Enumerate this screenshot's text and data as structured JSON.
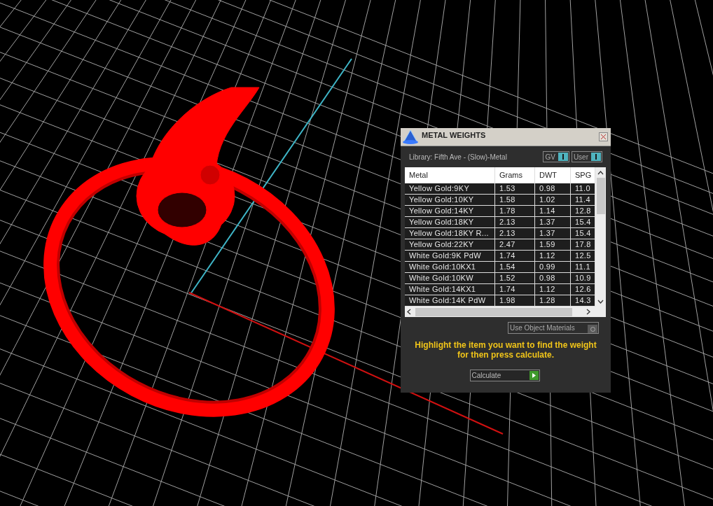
{
  "dialog": {
    "title": "METAL WEIGHTS",
    "library": "Library: Fifth Ave - (Slow)-Metal",
    "toggles": [
      {
        "label": "GV",
        "on": true
      },
      {
        "label": "User",
        "on": true
      }
    ],
    "table": {
      "columns": [
        "Metal",
        "Grams",
        "DWT",
        "SPG"
      ],
      "rows": [
        [
          "Yellow Gold:9KY",
          "1.53",
          "0.98",
          "11.0"
        ],
        [
          "Yellow Gold:10KY",
          "1.58",
          "1.02",
          "11.4"
        ],
        [
          "Yellow Gold:14KY",
          "1.78",
          "1.14",
          "12.8"
        ],
        [
          "Yellow Gold:18KY",
          "2.13",
          "1.37",
          "15.4"
        ],
        [
          "Yellow Gold:18KY R...",
          "2.13",
          "1.37",
          "15.4"
        ],
        [
          "Yellow Gold:22KY",
          "2.47",
          "1.59",
          "17.8"
        ],
        [
          "White Gold:9K PdW",
          "1.74",
          "1.12",
          "12.5"
        ],
        [
          "White Gold:10KX1",
          "1.54",
          "0.99",
          "11.1"
        ],
        [
          "White Gold:10KW",
          "1.52",
          "0.98",
          "10.9"
        ],
        [
          "White Gold:14KX1",
          "1.74",
          "1.12",
          "12.6"
        ],
        [
          "White Gold:14K PdW",
          "1.98",
          "1.28",
          "14.3"
        ]
      ]
    },
    "use_object_materials": {
      "label": "Use Object Materials",
      "on": false
    },
    "hint": "Highlight the item you want to find the weight for then press calculate.",
    "calculate": "Calculate"
  }
}
